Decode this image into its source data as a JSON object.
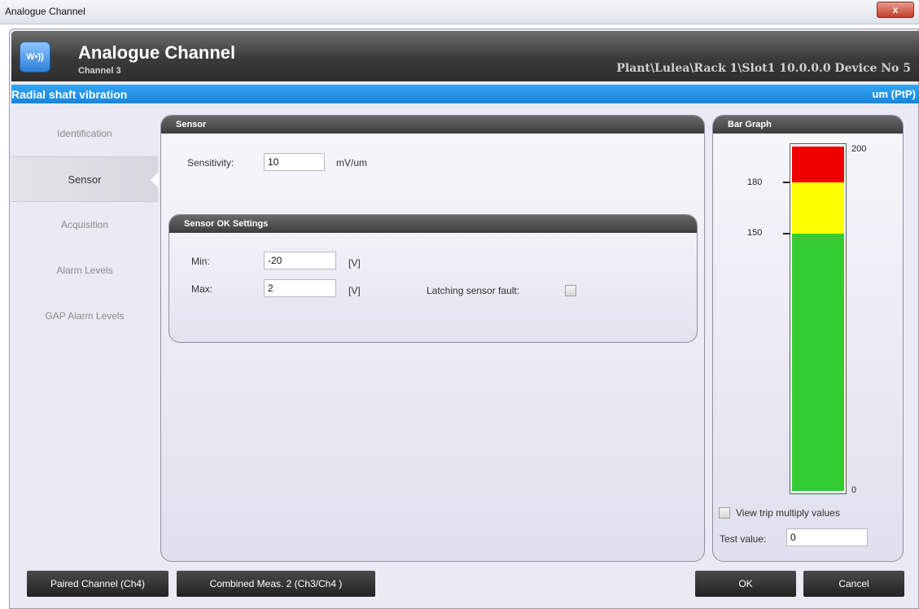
{
  "window": {
    "title": "Analogue Channel",
    "close_label": "x"
  },
  "header": {
    "logo_text": "W•))",
    "title": "Analogue Channel",
    "subtitle": "Channel 3",
    "path": "Plant\\Lulea\\Rack 1\\Slot1 10.0.0.0 Device No 5"
  },
  "measurement": {
    "name": "Radial shaft vibration",
    "unit": "um (PtP)"
  },
  "nav": {
    "items": [
      {
        "label": "Identification"
      },
      {
        "label": "Sensor"
      },
      {
        "label": "Acquisition"
      },
      {
        "label": "Alarm Levels"
      },
      {
        "label": "GAP Alarm Levels"
      }
    ],
    "active": "Sensor"
  },
  "sensor": {
    "title": "Sensor",
    "sensitivity_label": "Sensitivity:",
    "sensitivity_value": "10",
    "sensitivity_unit": "mV/um"
  },
  "sensor_ok": {
    "title": "Sensor OK Settings",
    "min_label": "Min:",
    "min_value": "-20",
    "min_unit": "[V]",
    "max_label": "Max:",
    "max_value": "2",
    "max_unit": "[V]",
    "latching_label": "Latching sensor fault:",
    "latching_checked": false
  },
  "bar_graph": {
    "title": "Bar Graph",
    "tick_labels": {
      "top": "200",
      "high": "180",
      "mid": "150",
      "bottom": "0"
    },
    "colors": {
      "red": "#ee0000",
      "yellow": "#ffff00",
      "green": "#33cc33"
    },
    "view_trip_label": "View trip multiply values",
    "view_trip_checked": false,
    "test_value_label": "Test value:",
    "test_value": "0"
  },
  "buttons": {
    "paired": "Paired Channel (Ch4)",
    "combined": "Combined Meas. 2 (Ch3/Ch4 )",
    "ok": "OK",
    "cancel": "Cancel"
  }
}
